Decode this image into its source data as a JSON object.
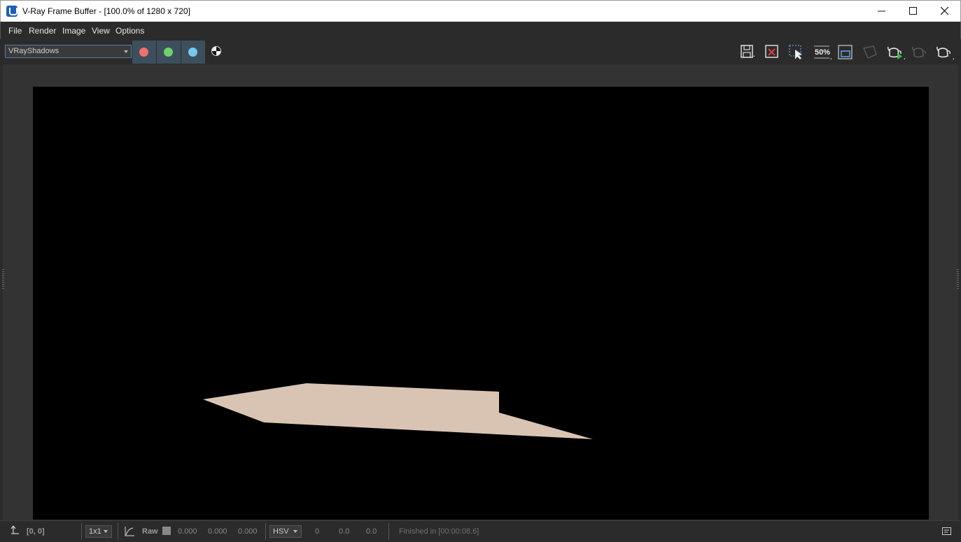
{
  "window": {
    "title": "V-Ray Frame Buffer - [100.0% of 1280 x 720]",
    "minimize_icon": "minimize-icon",
    "maximize_icon": "maximize-icon",
    "close_icon": "close-icon"
  },
  "menu": {
    "items": [
      "File",
      "Render",
      "Image",
      "View",
      "Options"
    ]
  },
  "toolbar": {
    "channel_selected": "VRayShadows",
    "channel_buttons": [
      {
        "name": "red-channel",
        "color": "#f07070"
      },
      {
        "name": "green-channel",
        "color": "#6fd26f"
      },
      {
        "name": "blue-channel",
        "color": "#78c8f0"
      }
    ],
    "zoom_label": "50%",
    "icons": [
      "save-icon",
      "clear-image-icon",
      "region-render-icon",
      "zoom-50-icon",
      "compare-icon",
      "stop-icon",
      "render-interactive-icon",
      "render-disabled-icon",
      "render-icon"
    ]
  },
  "render": {
    "background": "#000000",
    "shape_color": "#d9c4b4"
  },
  "statusbar": {
    "coords": "[0, 0]",
    "sample_size": "1x1",
    "raw_label": "Raw",
    "rgb_values": [
      "0.000",
      "0.000",
      "0.000"
    ],
    "color_mode": "HSV",
    "hsv_values": [
      "0",
      "0.0",
      "0.0"
    ],
    "status": "Finished in [00:00:08.6]"
  }
}
